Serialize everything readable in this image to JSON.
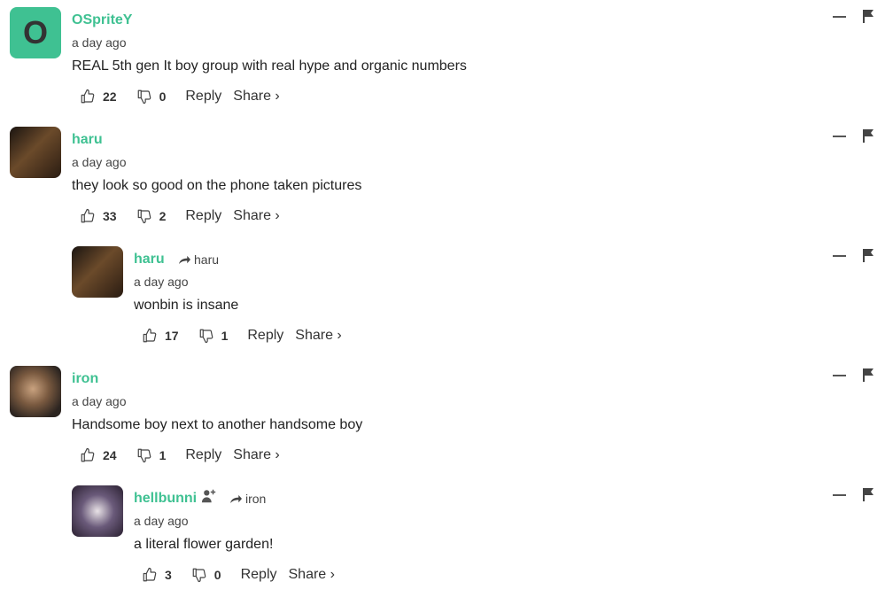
{
  "comments": [
    {
      "avatar_letter": "O",
      "username": "OSpriteY",
      "timestamp": "a day ago",
      "text": "REAL 5th gen It boy group with real hype and organic numbers",
      "upvotes": "22",
      "downvotes": "0",
      "reply_label": "Reply",
      "share_label": "Share ›"
    },
    {
      "username": "haru",
      "timestamp": "a day ago",
      "text": "they look so good on the phone taken pictures",
      "upvotes": "33",
      "downvotes": "2",
      "reply_label": "Reply",
      "share_label": "Share ›"
    },
    {
      "username": "haru",
      "reply_to": "haru",
      "timestamp": "a day ago",
      "text": "wonbin is insane",
      "upvotes": "17",
      "downvotes": "1",
      "reply_label": "Reply",
      "share_label": "Share ›"
    },
    {
      "username": "iron",
      "timestamp": "a day ago",
      "text": "Handsome boy next to another handsome boy",
      "upvotes": "24",
      "downvotes": "1",
      "reply_label": "Reply",
      "share_label": "Share ›"
    },
    {
      "username": "hellbunni",
      "reply_to": "iron",
      "timestamp": "a day ago",
      "text": "a literal flower garden!",
      "upvotes": "3",
      "downvotes": "0",
      "reply_label": "Reply",
      "share_label": "Share ›"
    }
  ],
  "colors": {
    "username": "#3fc192",
    "avatar_bg": "#3fc192"
  },
  "icons": [
    "thumbs-up-icon",
    "thumbs-down-icon",
    "reply-arrow-icon",
    "follow-user-icon",
    "collapse-icon",
    "flag-icon"
  ]
}
